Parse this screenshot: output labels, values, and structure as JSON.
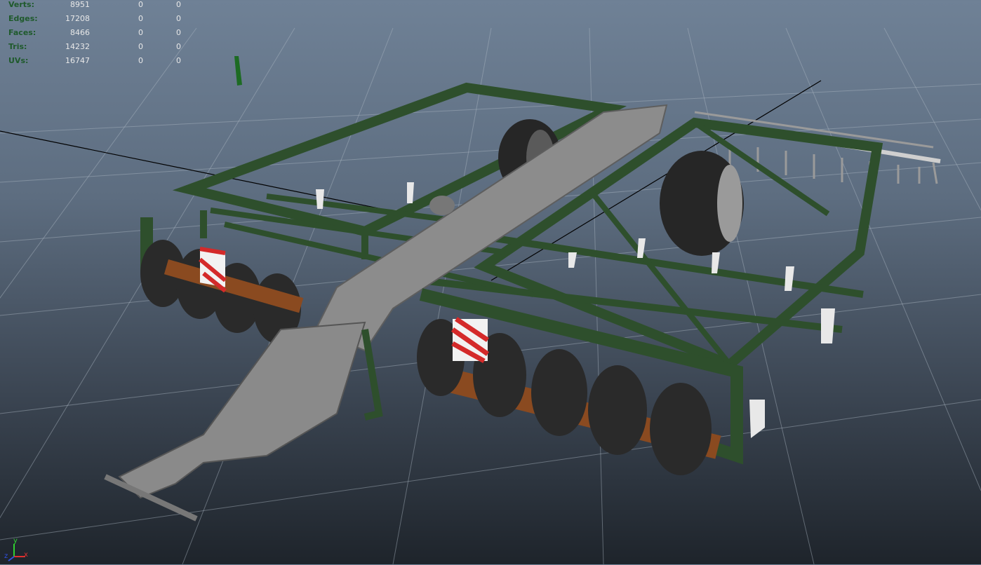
{
  "hud": {
    "rows": [
      {
        "label": "Verts:",
        "v1": "8951",
        "v2": "0",
        "v3": "0"
      },
      {
        "label": "Edges:",
        "v1": "17208",
        "v2": "0",
        "v3": "0"
      },
      {
        "label": "Faces:",
        "v1": "8466",
        "v2": "0",
        "v3": "0"
      },
      {
        "label": "Tris:",
        "v1": "14232",
        "v2": "0",
        "v3": "0"
      },
      {
        "label": "UVs:",
        "v1": "16747",
        "v2": "0",
        "v3": "0"
      }
    ]
  },
  "axis_gizmo": {
    "y_label": "y",
    "x_label": "x",
    "z_label": "z",
    "x_color": "#e03030",
    "y_color": "#30d030",
    "z_color": "#3050e0"
  },
  "colors": {
    "frame_green": "#2e4f2c",
    "tool_gray": "#8a8a8a",
    "tire": "#2a2a2a",
    "axle": "#8a4a20",
    "grid": "#9aa6b2"
  }
}
